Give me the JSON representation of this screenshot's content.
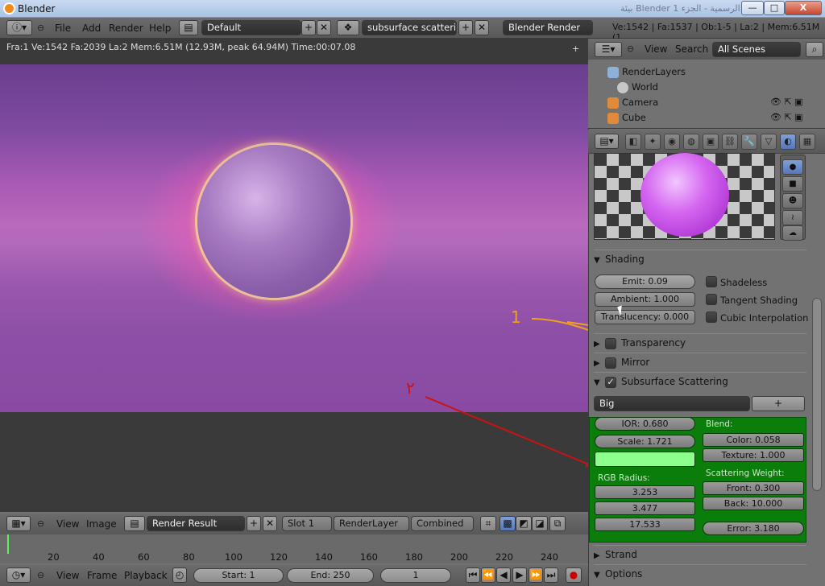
{
  "window": {
    "title": "Blender",
    "right_text": "بيئة Blender الرسمية - الجزء 1",
    "min": "—",
    "max": "□",
    "close": "X"
  },
  "header": {
    "menus": [
      "File",
      "Add",
      "Render",
      "Help"
    ],
    "layout_name": "Default",
    "scene_name": "subsurface scattering",
    "engine": "Blender Render",
    "stats": "Ve:1542 | Fa:1537 | Ob:1-5 | La:2 | Mem:6.51M (1"
  },
  "viewport": {
    "info": "Fra:1  Ve:1542 Fa:2039 La:2 Mem:6.51M (12.93M, peak 64.94M) Time:00:07.08",
    "annot1": "1",
    "annot2": "٢"
  },
  "outliner": {
    "view_label": "View",
    "search_label": "Search",
    "scene_dropdown": "All Scenes",
    "items": [
      {
        "label": "RenderLayers"
      },
      {
        "label": "World"
      },
      {
        "label": "Camera"
      },
      {
        "label": "Cube"
      }
    ]
  },
  "properties": {
    "shading": {
      "title": "Shading",
      "emit": "Emit: 0.09",
      "ambient": "Ambient: 1.000",
      "translucency": "Translucency: 0.000",
      "shadeless": "Shadeless",
      "tangent": "Tangent Shading",
      "cubic": "Cubic Interpolation"
    },
    "transparency": "Transparency",
    "mirror": "Mirror",
    "sss": {
      "title": "Subsurface Scattering",
      "preset": "Big",
      "add": "+",
      "ior": "IOR: 0.680",
      "scale": "Scale: 1.721",
      "rgb_radius_label": "RGB Radius:",
      "radius": [
        "3.253",
        "3.477",
        "17.533"
      ],
      "blend_label": "Blend:",
      "color": "Color: 0.058",
      "texture": "Texture: 1.000",
      "weight_label": "Scattering Weight:",
      "front": "Front: 0.300",
      "back": "Back: 10.000",
      "error": "Error: 3.180"
    },
    "strand": "Strand",
    "options": "Options"
  },
  "image_header": {
    "view": "View",
    "image": "Image",
    "render_result": "Render Result",
    "slot": "Slot 1",
    "layer": "RenderLayer",
    "pass": "Combined"
  },
  "timeline": {
    "ticks": [
      "20",
      "40",
      "60",
      "80",
      "100",
      "120",
      "140",
      "160",
      "180",
      "200",
      "220",
      "240"
    ],
    "view": "View",
    "frame": "Frame",
    "playback": "Playback",
    "start": "Start: 1",
    "end": "End: 250",
    "current": "1"
  },
  "colors": {
    "sss_panel": "#0a7d0a",
    "annot1_arrow": "#f0a020",
    "annot2_arrow": "#cc1111"
  }
}
